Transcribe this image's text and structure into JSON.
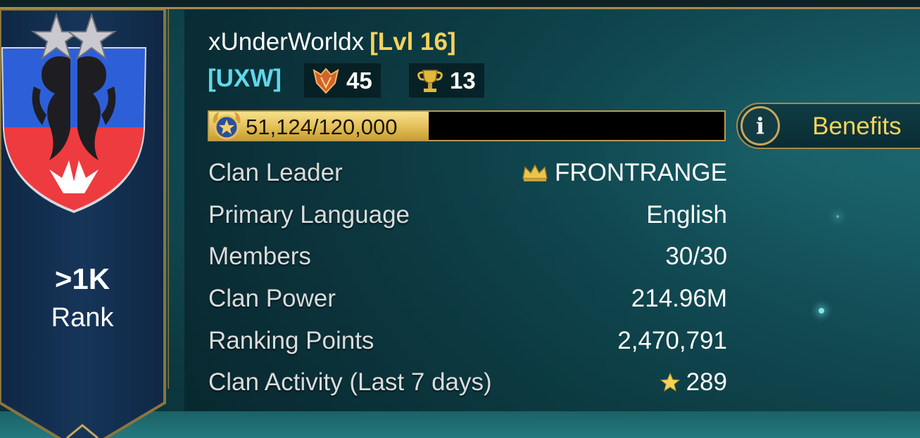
{
  "rank": {
    "value": ">1K",
    "label": "Rank"
  },
  "clan": {
    "name": "xUnderWorldx",
    "level": "[Lvl 16]",
    "tag": "[UXW]",
    "badges": [
      {
        "icon": "battle-crest-icon",
        "count": "45"
      },
      {
        "icon": "trophy-icon",
        "count": "13"
      }
    ]
  },
  "xp": {
    "text": "51,124/120,000",
    "fraction": 0.426
  },
  "benefits": {
    "label": "Benefits",
    "icon": "info-icon"
  },
  "details": [
    {
      "label": "Clan Leader",
      "value": "FRONTRANGE",
      "icon": "crown-icon"
    },
    {
      "label": "Primary Language",
      "value": "English"
    },
    {
      "label": "Members",
      "value": "30/30"
    },
    {
      "label": "Clan Power",
      "value": "214.96M"
    },
    {
      "label": "Ranking Points",
      "value": "2,470,791"
    },
    {
      "label": "Clan Activity (Last 7 days)",
      "value": "289",
      "icon": "star-icon"
    }
  ],
  "colors": {
    "accent_gold": "#f3d35a",
    "tag_cyan": "#5fd8ea",
    "border_gold": "#a9894a"
  }
}
